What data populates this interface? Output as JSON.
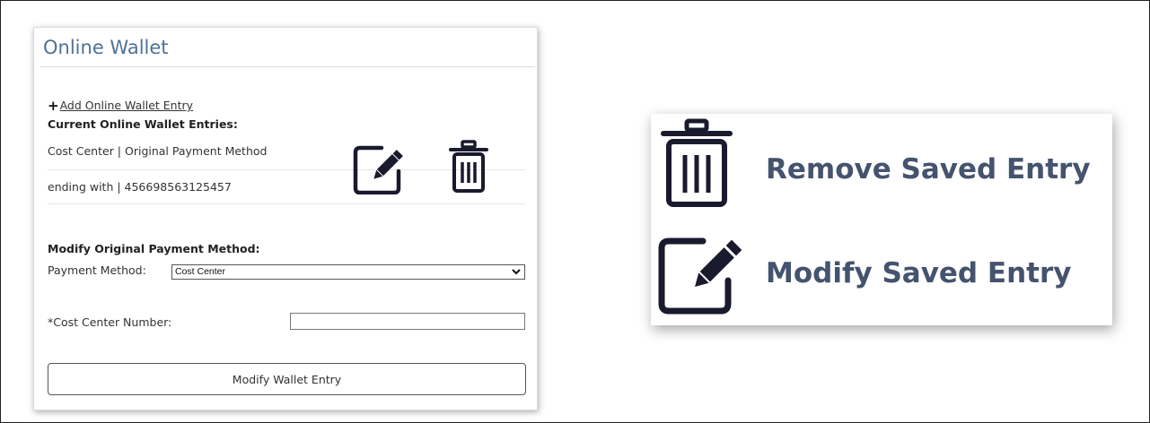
{
  "wallet": {
    "title": "Online Wallet",
    "add_entry_label": "Add Online Wallet Entry",
    "current_entries_heading": "Current Online Wallet Entries:",
    "entry": {
      "line1": "Cost Center | Original Payment Method",
      "line2": "ending with | 456698563125457",
      "edit_icon": "edit-icon",
      "delete_icon": "trash-icon"
    },
    "modify_heading": "Modify Original Payment Method:",
    "payment_method_label": "Payment Method:",
    "payment_method_value": "Cost Center",
    "cost_center_label": "*Cost Center Number:",
    "cost_center_value": "",
    "modify_button_label": "Modify Wallet Entry"
  },
  "legend": {
    "items": [
      {
        "icon": "trash-icon",
        "label": "Remove Saved Entry"
      },
      {
        "icon": "edit-icon",
        "label": "Modify Saved Entry"
      }
    ]
  },
  "colors": {
    "title": "#4f7198",
    "legend_text": "#44536e",
    "icon_dark": "#1a1a2e"
  }
}
